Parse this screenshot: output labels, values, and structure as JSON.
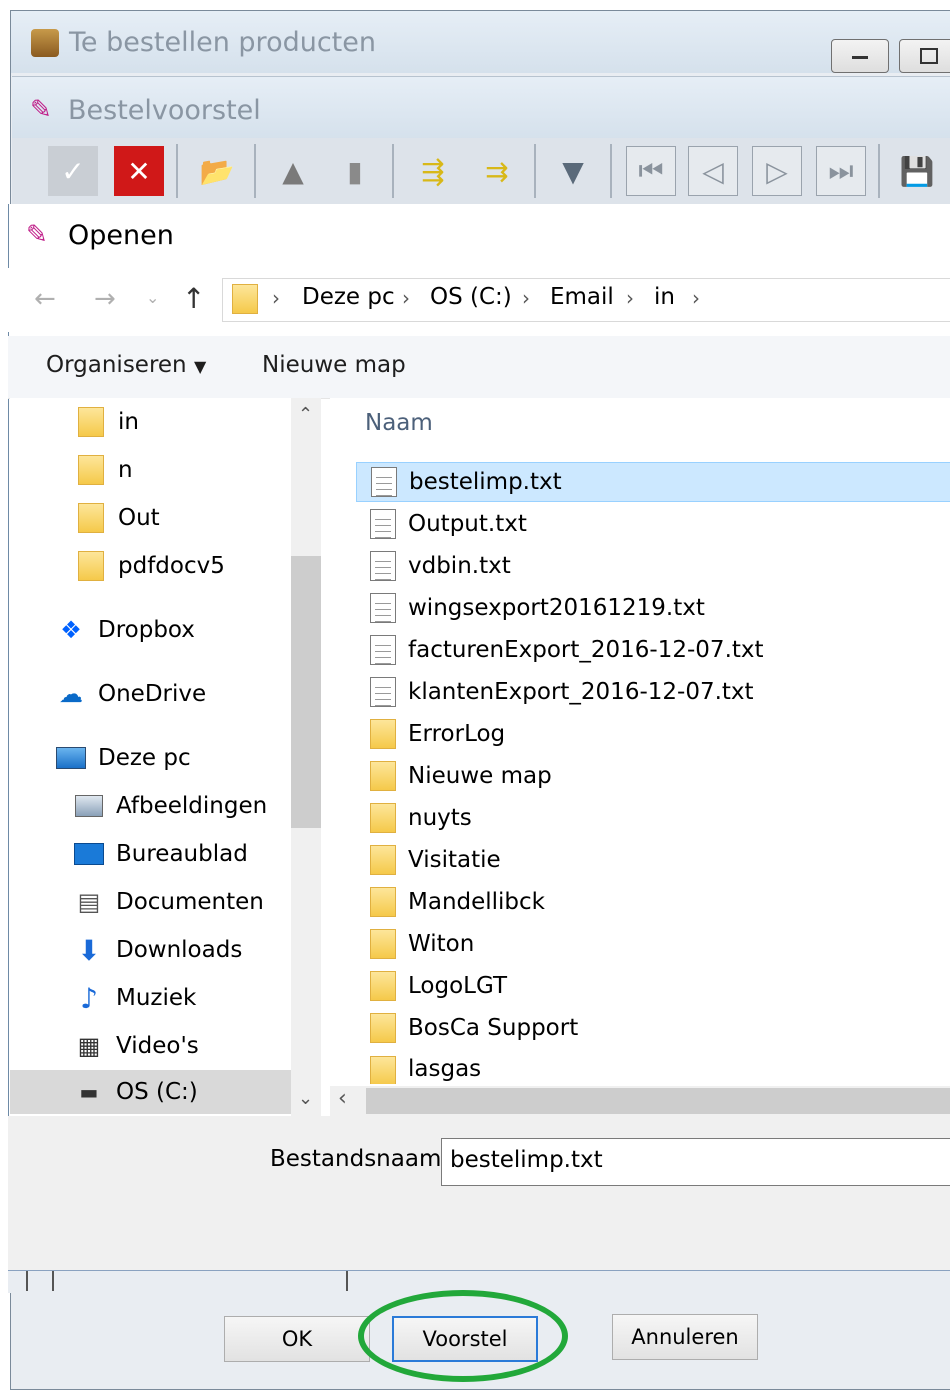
{
  "outer_window": {
    "title": "Te bestellen producten"
  },
  "inner_window": {
    "title": "Bestelvoorstel"
  },
  "dialog": {
    "title": "Openen",
    "breadcrumb": [
      "Deze pc",
      "OS (C:)",
      "Email",
      "in"
    ],
    "commands": {
      "organise": "Organiseren",
      "new_folder": "Nieuwe map"
    },
    "nav": [
      {
        "label": "in",
        "icon": "folder-icon"
      },
      {
        "label": "n",
        "icon": "folder-icon"
      },
      {
        "label": "Out",
        "icon": "folder-icon"
      },
      {
        "label": "pdfdocv5",
        "icon": "folder-icon"
      },
      {
        "label": "Dropbox",
        "icon": "dropbox-icon"
      },
      {
        "label": "OneDrive",
        "icon": "onedrive-icon"
      },
      {
        "label": "Deze pc",
        "icon": "computer-icon"
      },
      {
        "label": "Afbeeldingen",
        "icon": "pictures-icon"
      },
      {
        "label": "Bureaublad",
        "icon": "desktop-icon"
      },
      {
        "label": "Documenten",
        "icon": "documents-icon"
      },
      {
        "label": "Downloads",
        "icon": "downloads-icon"
      },
      {
        "label": "Muziek",
        "icon": "music-icon"
      },
      {
        "label": "Video's",
        "icon": "video-icon"
      },
      {
        "label": "OS (C:)",
        "icon": "drive-icon"
      }
    ],
    "column_name": "Naam",
    "files": [
      {
        "name": "bestelimp.txt",
        "type": "file",
        "selected": true
      },
      {
        "name": "Output.txt",
        "type": "file"
      },
      {
        "name": "vdbin.txt",
        "type": "file"
      },
      {
        "name": "wingsexport20161219.txt",
        "type": "file"
      },
      {
        "name": "facturenExport_2016-12-07.txt",
        "type": "file"
      },
      {
        "name": "klantenExport_2016-12-07.txt",
        "type": "file"
      },
      {
        "name": "ErrorLog",
        "type": "folder"
      },
      {
        "name": "Nieuwe map",
        "type": "folder"
      },
      {
        "name": "nuyts",
        "type": "folder"
      },
      {
        "name": "Visitatie",
        "type": "folder"
      },
      {
        "name": "Mandellibck",
        "type": "folder"
      },
      {
        "name": "Witon",
        "type": "folder"
      },
      {
        "name": "LogoLGT",
        "type": "folder"
      },
      {
        "name": "BosCa Support",
        "type": "folder"
      },
      {
        "name": "lasgas",
        "type": "folder"
      }
    ],
    "filename_label": "Bestandsnaam:",
    "filename_value": "bestelimp.txt"
  },
  "buttons": {
    "ok": "OK",
    "proposal": "Voorstel",
    "cancel": "Annuleren"
  },
  "colors": {
    "selection": "#cce8ff",
    "highlight_circle": "#22a83a",
    "folder": "#f5c94a"
  }
}
